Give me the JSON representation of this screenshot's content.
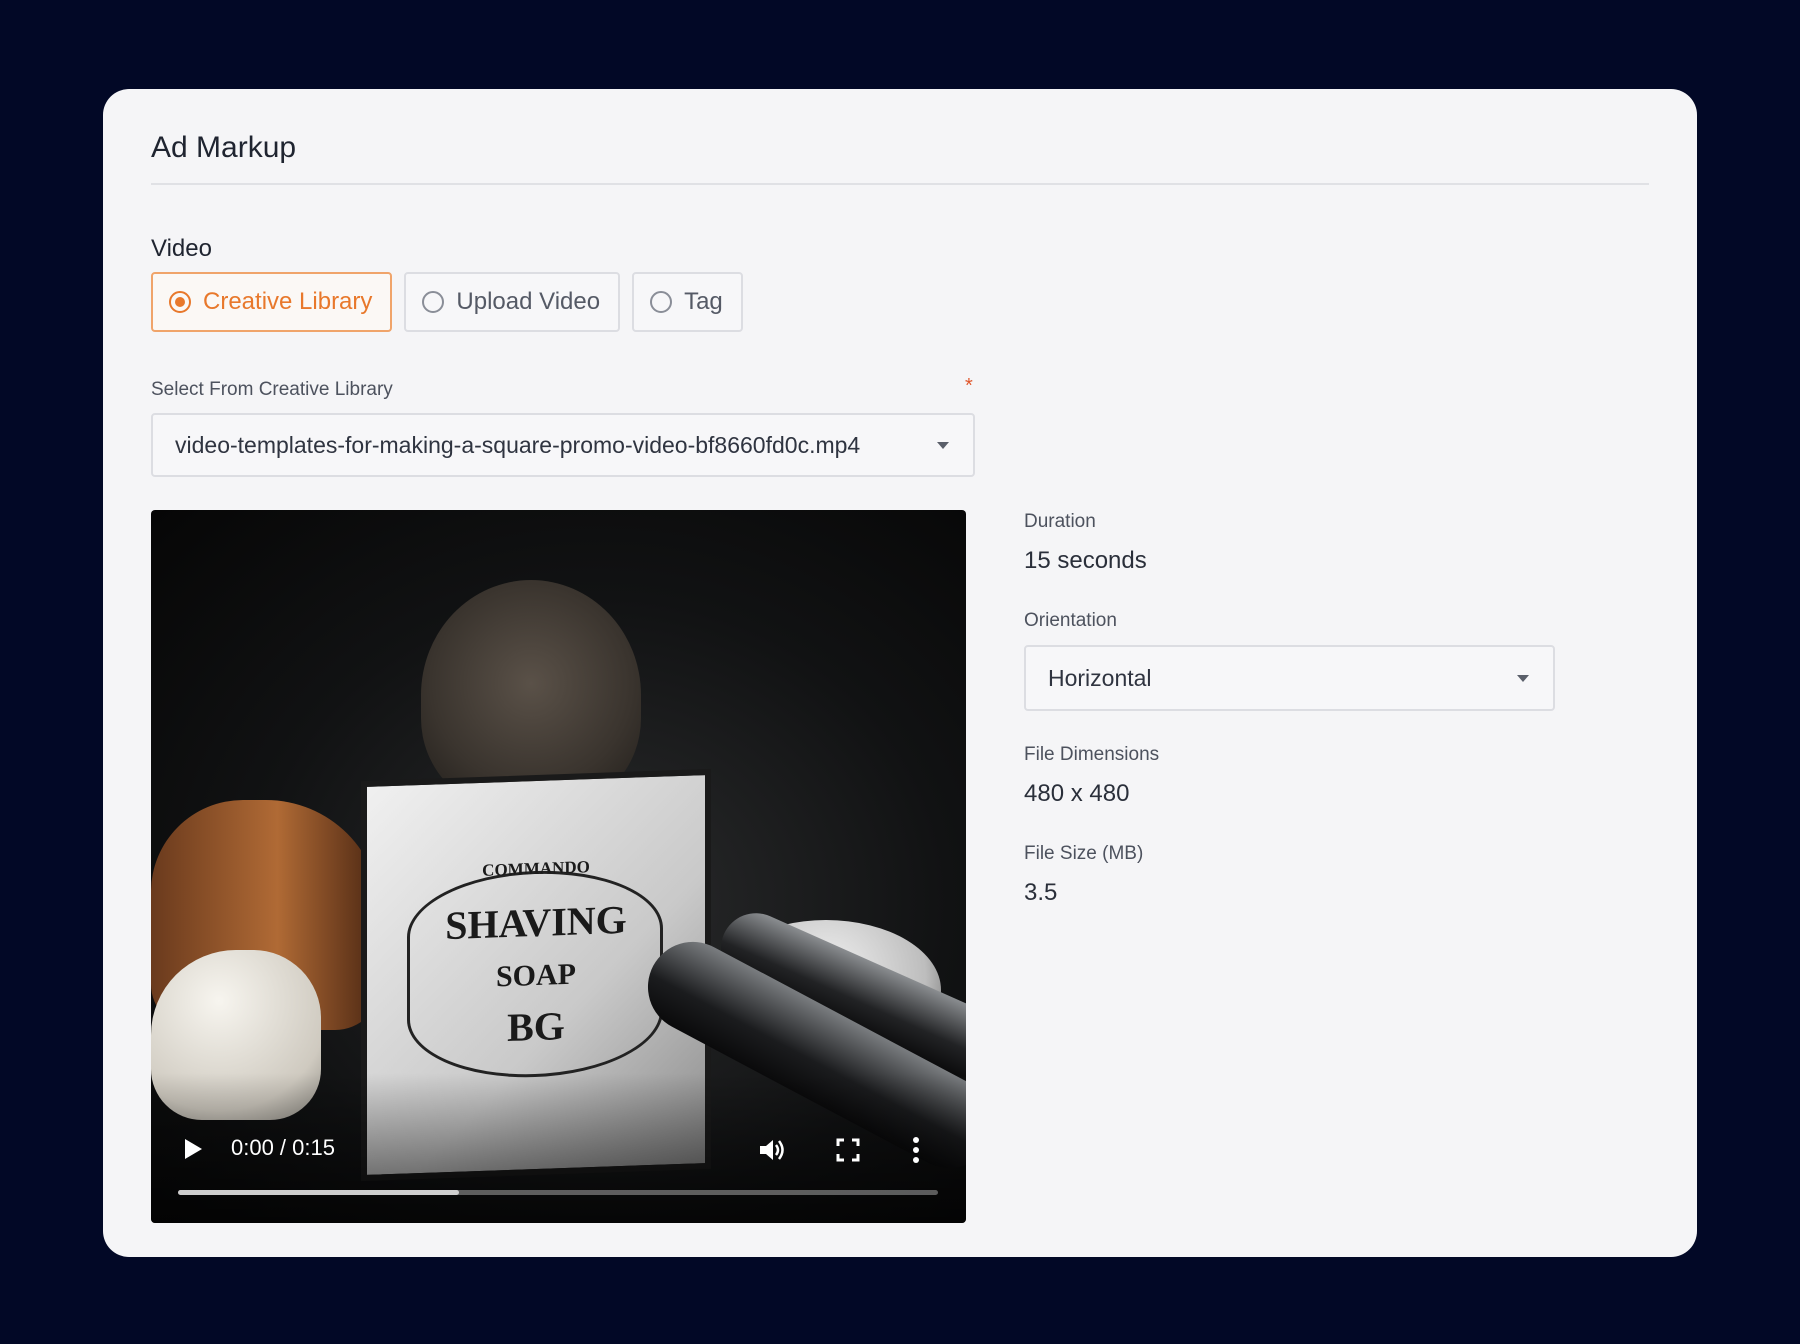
{
  "card": {
    "title": "Ad Markup"
  },
  "video_section": {
    "label": "Video",
    "options": [
      {
        "label": "Creative Library",
        "selected": true
      },
      {
        "label": "Upload Video",
        "selected": false
      },
      {
        "label": "Tag",
        "selected": false
      }
    ]
  },
  "creative_select": {
    "label": "Select From Creative Library",
    "required_marker": "*",
    "value": "video-templates-for-making-a-square-promo-video-bf8660fd0c.mp4"
  },
  "player": {
    "time": "0:00 / 0:15",
    "buffered_fraction": 0.37,
    "soapbox_texts": [
      "COMMANDO",
      "SHAVING",
      "SOAP",
      "BG"
    ]
  },
  "details": {
    "duration_label": "Duration",
    "duration_value": "15 seconds",
    "orientation_label": "Orientation",
    "orientation_value": "Horizontal",
    "dimensions_label": "File Dimensions",
    "dimensions_value": "480 x 480",
    "size_label": "File Size (MB)",
    "size_value": "3.5"
  },
  "colors": {
    "accent": "#e8782b",
    "page_background": "#020826",
    "card_background": "#f5f5f7"
  }
}
